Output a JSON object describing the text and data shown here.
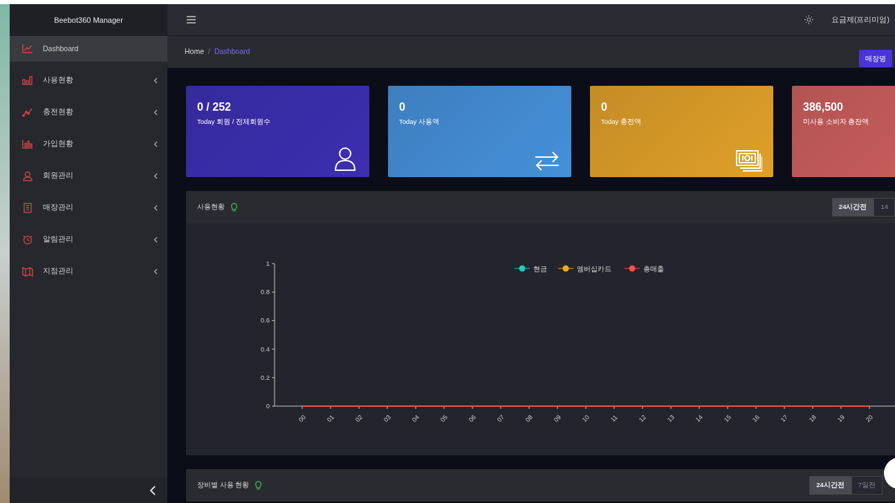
{
  "sidebar": {
    "brand": "Beebot360 Manager",
    "items": [
      {
        "label": "Dashboard",
        "kind": "line-chart",
        "selected": true,
        "has_submenu": false
      },
      {
        "label": "사용현황",
        "kind": "bar-chart",
        "selected": false,
        "has_submenu": true
      },
      {
        "label": "충전현황",
        "kind": "trend",
        "selected": false,
        "has_submenu": true
      },
      {
        "label": "가입현황",
        "kind": "column-chart",
        "selected": false,
        "has_submenu": true
      },
      {
        "label": "회원관리",
        "kind": "users",
        "selected": false,
        "has_submenu": true
      },
      {
        "label": "매장관리",
        "kind": "building",
        "selected": false,
        "has_submenu": true
      },
      {
        "label": "알림관리",
        "kind": "alarm",
        "selected": false,
        "has_submenu": true
      },
      {
        "label": "지점관리",
        "kind": "map",
        "selected": false,
        "has_submenu": true
      }
    ]
  },
  "topbar": {
    "plan": "요금제(프리미엄)"
  },
  "breadcrumb": {
    "items": [
      "Home",
      "Dashboard"
    ],
    "separator": "/",
    "button": "매장명"
  },
  "stat_cards": [
    {
      "value": "0 / 252",
      "label": "Today 회원 / 전체회원수",
      "color": "#3b2fb0",
      "kind": "user"
    },
    {
      "value": "0",
      "label": "Today 사용액",
      "color": "#4590d8",
      "kind": "transfer"
    },
    {
      "value": "0",
      "label": "Today 충전액",
      "color": "#e0a028",
      "kind": "money"
    },
    {
      "value": "386,500",
      "label": "미사용 소비자 총잔액",
      "color": "#cc5f5c",
      "kind": "none"
    }
  ],
  "usage_panel": {
    "title": "사용현황",
    "ranges": [
      {
        "label": "24시간전",
        "selected": true
      },
      {
        "label": "14",
        "selected": false
      }
    ],
    "chart_data": {
      "type": "line",
      "legend": true,
      "categories": [
        "00",
        "01",
        "02",
        "03",
        "04",
        "05",
        "06",
        "07",
        "08",
        "09",
        "10",
        "11",
        "12",
        "13",
        "14",
        "15",
        "16",
        "17",
        "18",
        "19",
        "20"
      ],
      "yticks": [
        0,
        0.2,
        0.4,
        0.6,
        0.8,
        1
      ],
      "ylim": [
        0,
        1
      ],
      "series": [
        {
          "name": "현금",
          "color": "#2ec4c0",
          "values": [
            null,
            null,
            null,
            null,
            null,
            null,
            null,
            null,
            null,
            null,
            null,
            null,
            null,
            null,
            null,
            null,
            null,
            null,
            null,
            null,
            null
          ]
        },
        {
          "name": "멤버십카드",
          "color": "#f5a623",
          "values": [
            null,
            null,
            null,
            null,
            null,
            null,
            null,
            null,
            null,
            null,
            null,
            null,
            null,
            null,
            null,
            null,
            null,
            null,
            null,
            null,
            null
          ]
        },
        {
          "name": "총매출",
          "color": "#f0553f",
          "values": [
            0,
            0,
            0,
            0,
            0,
            0,
            0,
            0,
            0,
            0,
            0,
            0,
            0,
            0,
            0,
            0,
            0,
            0,
            0,
            0,
            0
          ]
        }
      ]
    }
  },
  "device_panel": {
    "title": "장비별 사용 현황",
    "ranges": [
      {
        "label": "24시간전",
        "selected": true
      },
      {
        "label": "7일전",
        "selected": false
      }
    ]
  }
}
